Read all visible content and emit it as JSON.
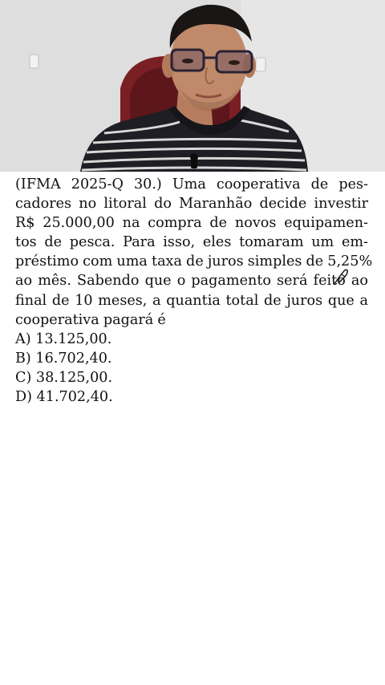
{
  "question": {
    "lines": [
      "(IFMA 2025-Q 30.) Uma cooperativa de pes-",
      "cadores no litoral do Maranhão decide investir",
      "R$ 25.000,00 na compra de novos equipamen-",
      "tos de pesca. Para isso, eles tomaram um em-",
      "préstimo com uma taxa de juros simples de 5,25%",
      "ao mês. Sabendo que o pagamento será feito ao",
      "final de 10 meses, a quantia total de juros que a",
      "cooperativa pagará é"
    ]
  },
  "options": [
    "A) 13.125,00.",
    "B) 16.702,40.",
    "C) 38.125,00.",
    "D) 41.702,40."
  ],
  "colors": {
    "text": "#111111",
    "background": "#ffffff",
    "wall": "#dedede",
    "shirt_dark": "#1e1e24",
    "shirt_stripe": "#d8d8d8",
    "chair_red": "#7a1f24"
  }
}
